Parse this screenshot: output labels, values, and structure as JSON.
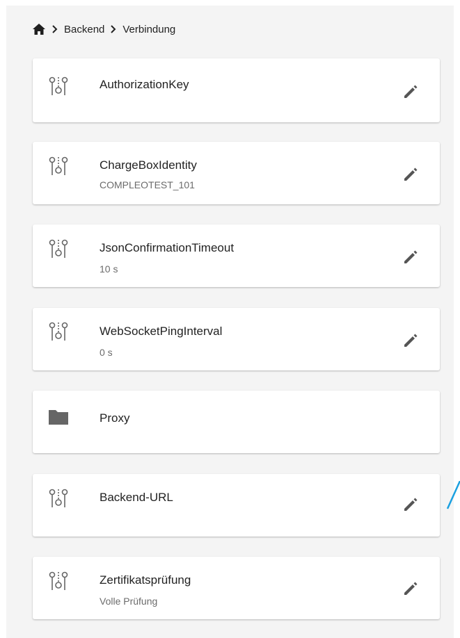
{
  "colors": {
    "panel_bg": "#f4f4f4",
    "card_bg": "#ffffff",
    "icon": "#666666",
    "edit_icon": "#555555",
    "annotation_arrow": "#1aa0e0"
  },
  "breadcrumb": {
    "home_icon": "home-icon",
    "items": [
      "Backend",
      "Verbindung"
    ]
  },
  "items": [
    {
      "icon": "config-parameter-icon",
      "title": "AuthorizationKey",
      "subtitle": "",
      "editable": true
    },
    {
      "icon": "config-parameter-icon",
      "title": "ChargeBoxIdentity",
      "subtitle": "COMPLEOTEST_101",
      "editable": true
    },
    {
      "icon": "config-parameter-icon",
      "title": "JsonConfirmationTimeout",
      "subtitle": "10 s",
      "editable": true
    },
    {
      "icon": "config-parameter-icon",
      "title": "WebSocketPingInterval",
      "subtitle": "0 s",
      "editable": true
    },
    {
      "icon": "folder-icon",
      "title": "Proxy",
      "subtitle": "",
      "editable": false
    },
    {
      "icon": "config-parameter-icon",
      "title": "Backend-URL",
      "subtitle": "",
      "editable": true
    },
    {
      "icon": "config-parameter-icon",
      "title": "Zertifikatsprüfung",
      "subtitle": "Volle Prüfung",
      "editable": true
    }
  ]
}
